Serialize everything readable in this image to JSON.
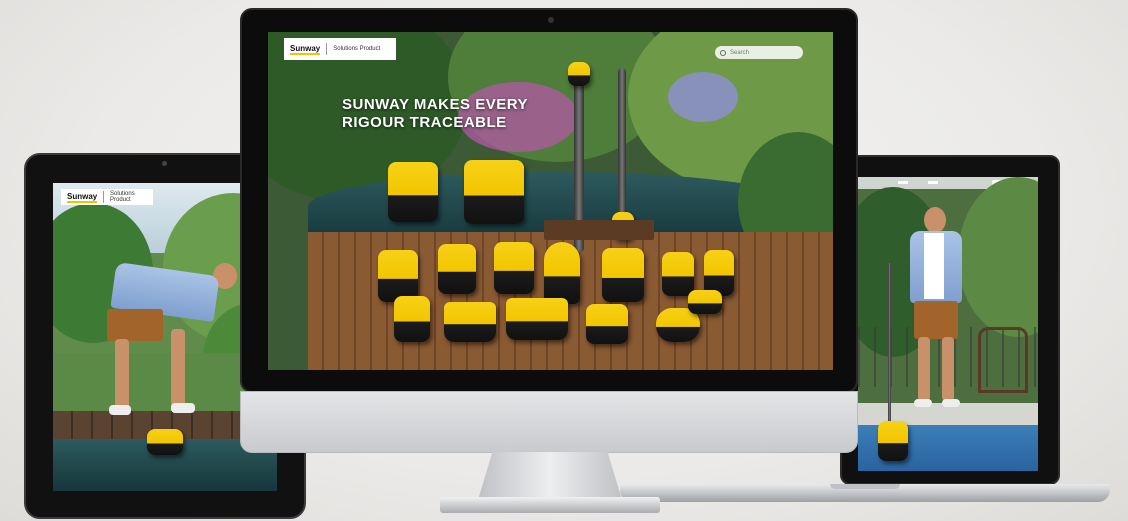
{
  "imac": {
    "brand_mark": "Sunway",
    "brand_tagline": "Solutions Product",
    "headline_line1": "SUNWAY MAKES EVERY",
    "headline_line2": "RIGOUR TRACEABLE",
    "search_placeholder": "Search"
  },
  "tablet": {
    "brand_mark": "Sunway",
    "brand_tagline": "Solutions Product"
  },
  "laptop": {
    "menu_icon": "menu-icon"
  },
  "colors": {
    "brand_yellow": "#f2c500",
    "bezel": "#0c0c0c",
    "aluminium": "#d6d8da"
  }
}
